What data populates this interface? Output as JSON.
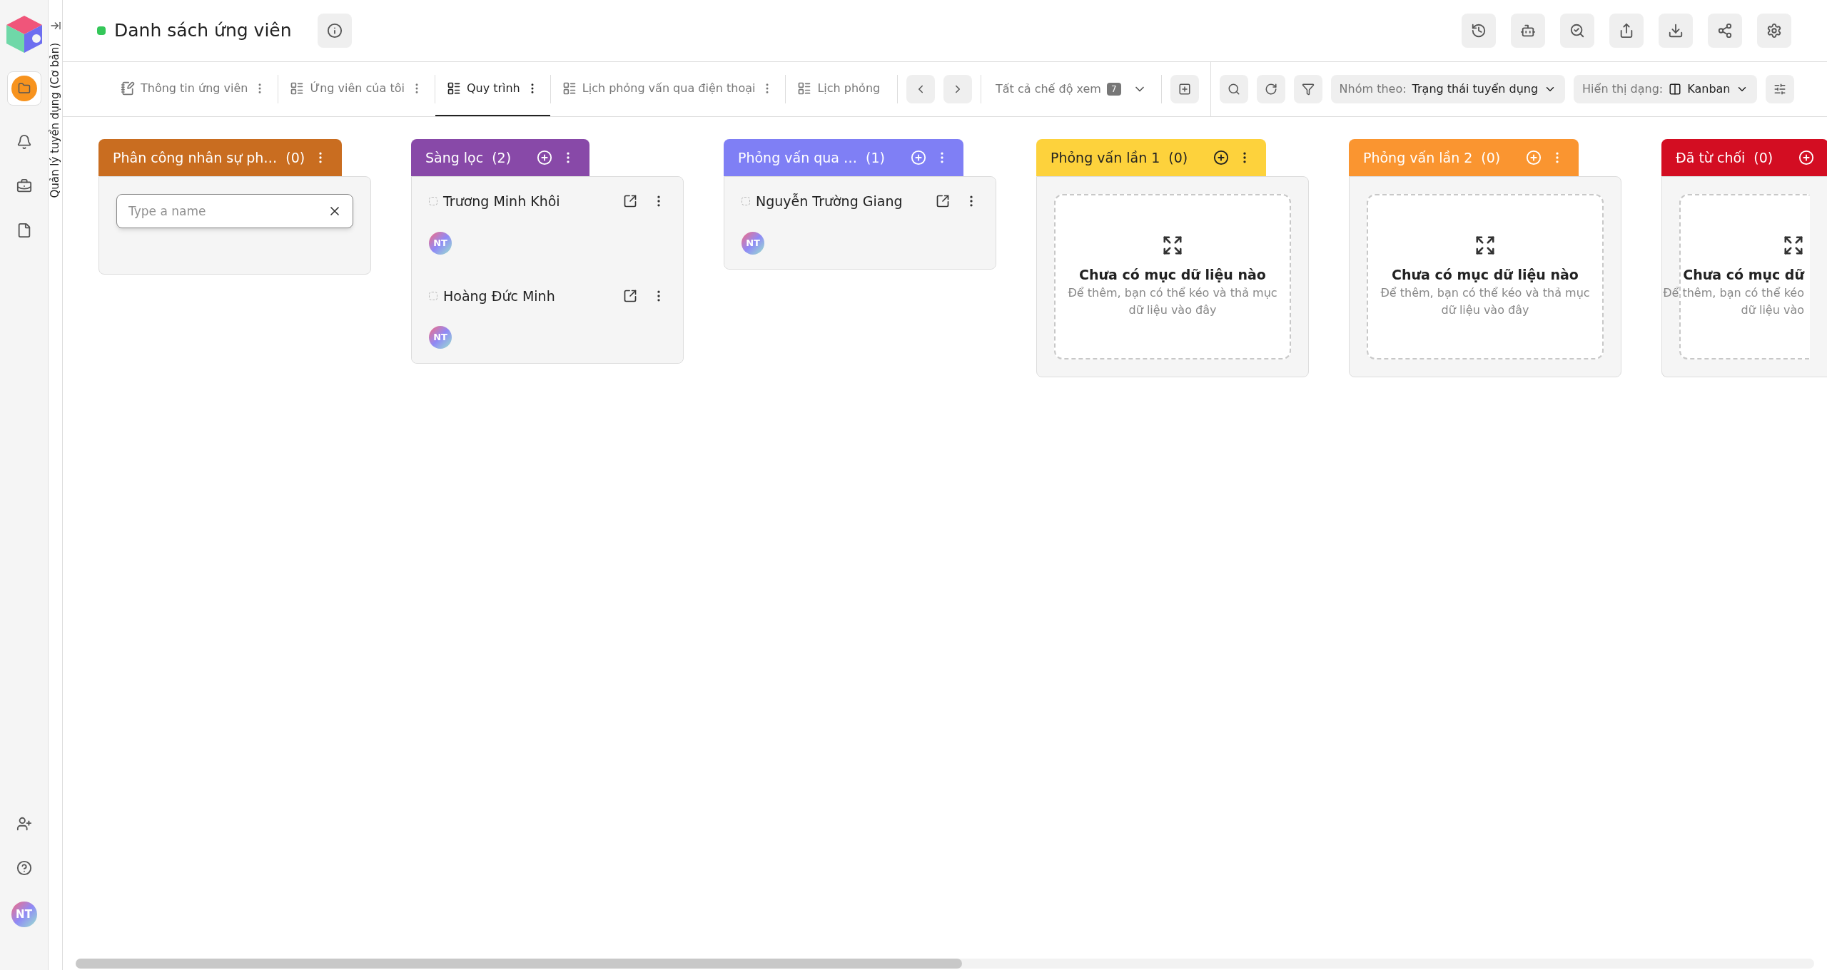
{
  "module_label": "Quản lý tuyển dụng (Cơ bản)",
  "sidebar": {
    "avatar": "NT"
  },
  "header": {
    "title": "Danh sách ứng viên"
  },
  "tabs": [
    {
      "label": "Thông tin ứng viên",
      "selected": false,
      "kind": "form"
    },
    {
      "label": "Ứng viên của tôi",
      "selected": false,
      "kind": "table"
    },
    {
      "label": "Quy trình",
      "selected": true,
      "kind": "table"
    },
    {
      "label": "Lịch phỏng vấn qua điện thoại",
      "selected": false,
      "kind": "table"
    },
    {
      "label": "Lịch phỏng",
      "selected": false,
      "kind": "table"
    }
  ],
  "views": {
    "label": "Tất cả chế độ xem",
    "count": "7"
  },
  "group_by": {
    "label": "Nhóm theo:",
    "value": "Trạng thái tuyển dụng"
  },
  "display": {
    "label": "Hiển thị dạng:",
    "value": "Kanban"
  },
  "columns": [
    {
      "title": "Phân công nhân sự ph…",
      "count": "(0)",
      "color": "#c96d20",
      "kind": "input",
      "placeholder": "Type a name"
    },
    {
      "title": "Sàng lọc",
      "count": "(2)",
      "color": "#8849a8",
      "kind": "cards",
      "cards": [
        {
          "name": "Trương Minh Khôi",
          "checked": false,
          "avatar": "NT"
        },
        {
          "name": "Hoàng Đức Minh",
          "checked": false,
          "avatar": "NT"
        }
      ]
    },
    {
      "title": "Phỏng vấn qua …",
      "count": "(1)",
      "color": "#7f7ff5",
      "kind": "cards",
      "cards": [
        {
          "name": "Nguyễn Trường Giang",
          "checked": false,
          "avatar": "NT"
        }
      ]
    },
    {
      "title": "Phỏng vấn lần 1",
      "count": "(0)",
      "color": "#fdd23c",
      "kind": "empty",
      "empty_title": "Chưa có mục dữ liệu nào",
      "empty_lines": [
        "Để thêm, bạn có thể kéo và thả mục",
        "dữ liệu vào đây"
      ]
    },
    {
      "title": "Phỏng vấn lần 2",
      "count": "(0)",
      "color": "#fa9530",
      "kind": "empty",
      "empty_title": "Chưa có mục dữ liệu nào",
      "empty_lines": [
        "Để thêm, bạn có thể kéo và thả mục",
        "dữ liệu vào đây"
      ]
    },
    {
      "title": "Đã từ chối",
      "count": "(0)",
      "color": "#d30d22",
      "kind": "empty",
      "empty_title": "Chưa có mục dữ",
      "empty_lines": [
        "Để thêm, bạn có thể kéo",
        "dữ liệu vào"
      ]
    }
  ]
}
